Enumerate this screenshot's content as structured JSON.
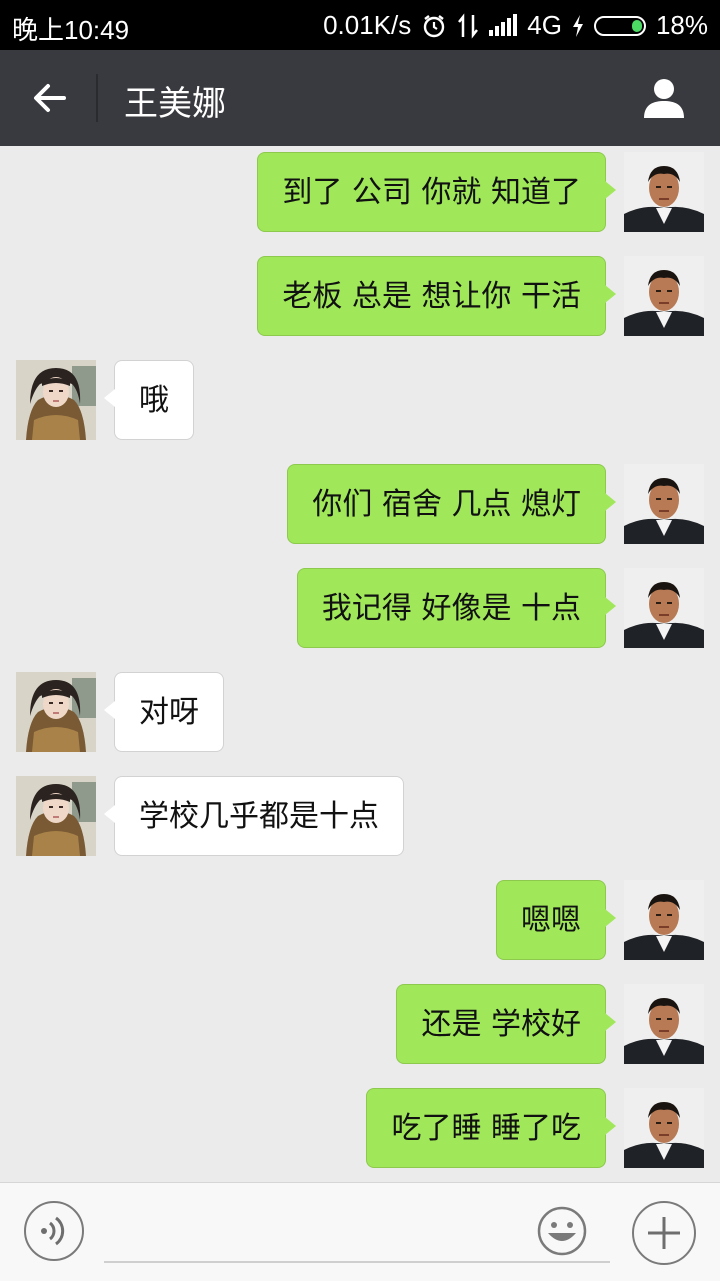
{
  "status_bar": {
    "time": "晚上10:49",
    "speed": "0.01K/s",
    "network": "4G",
    "battery": "18%"
  },
  "header": {
    "title": "王美娜",
    "back_icon": "arrow-left-icon",
    "profile_icon": "person-icon"
  },
  "messages": [
    {
      "sender": "me",
      "text": "到了 公司 你就 知道了"
    },
    {
      "sender": "me",
      "text": "老板 总是 想让你 干活"
    },
    {
      "sender": "her",
      "text": "哦"
    },
    {
      "sender": "me",
      "text": "你们 宿舍 几点 熄灯"
    },
    {
      "sender": "me",
      "text": "我记得 好像是 十点"
    },
    {
      "sender": "her",
      "text": "对呀"
    },
    {
      "sender": "her",
      "text": "学校几乎都是十点"
    },
    {
      "sender": "me",
      "text": "嗯嗯"
    },
    {
      "sender": "me",
      "text": "还是 学校好"
    },
    {
      "sender": "me",
      "text": "吃了睡 睡了吃"
    }
  ],
  "input_bar": {
    "voice_icon": "voice-icon",
    "emoji_icon": "smiley-icon",
    "more_icon": "plus-icon",
    "text_value": ""
  },
  "colors": {
    "title_bar": "#393a3f",
    "my_bubble": "#a0e75a",
    "her_bubble": "#ffffff",
    "background": "#ebebeb"
  }
}
